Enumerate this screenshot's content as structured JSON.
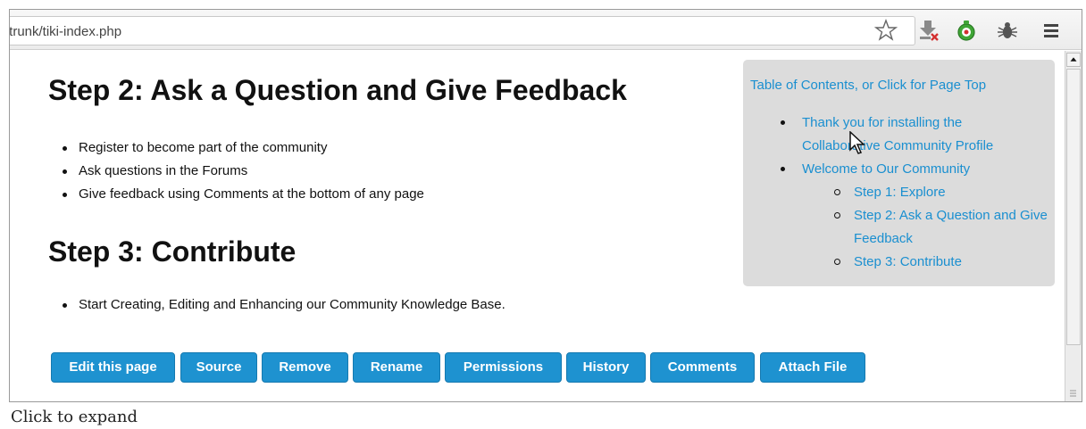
{
  "browser": {
    "url": "/trunk/tiki-index.php",
    "toolbar_icons": [
      "bookmark-star-icon",
      "download-icon",
      "stopwatch-icon",
      "firebug-icon",
      "hamburger-menu-icon"
    ]
  },
  "content": {
    "step2": {
      "heading": "Step 2: Ask a Question and Give Feedback",
      "items": [
        "Register to become part of the community",
        "Ask questions in the Forums",
        "Give feedback using Comments at the bottom of any page"
      ]
    },
    "step3": {
      "heading": "Step 3: Contribute",
      "items": [
        "Start Creating, Editing and Enhancing our Community Knowledge Base."
      ]
    }
  },
  "toc": {
    "title": "Table of Contents, or Click for Page Top",
    "items": [
      "Thank you for installing the Collaborative Community Profile",
      "Welcome to Our Community"
    ],
    "subitems": [
      "Step 1: Explore",
      "Step 2: Ask a Question and Give Feedback",
      "Step 3: Contribute"
    ]
  },
  "actions": {
    "buttons": [
      "Edit this page",
      "Source",
      "Remove",
      "Rename",
      "Permissions",
      "History",
      "Comments",
      "Attach File"
    ],
    "color": "#1e92d0"
  },
  "caption": "Click to expand"
}
